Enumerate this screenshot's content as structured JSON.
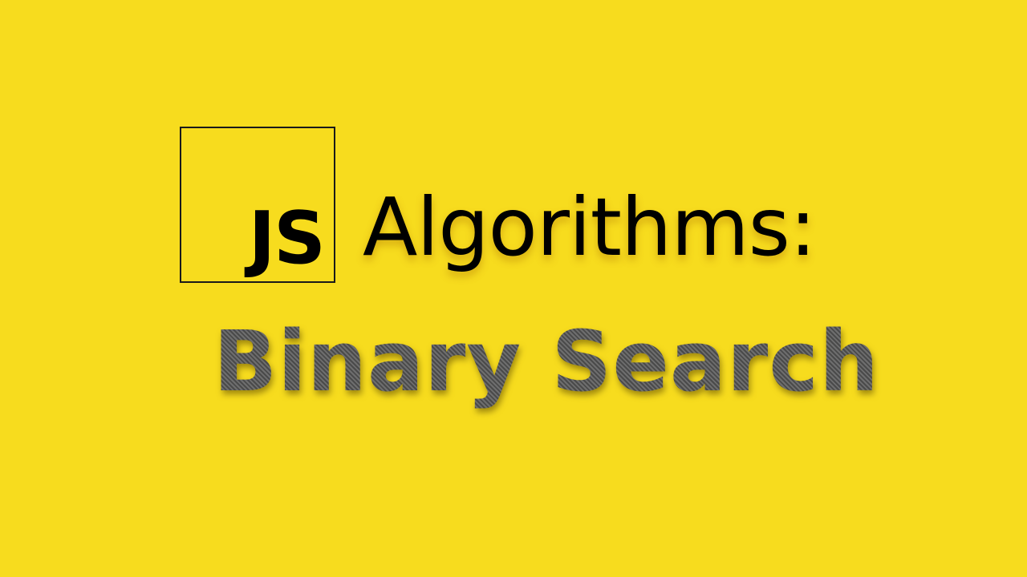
{
  "slide": {
    "logo": {
      "text": "JS"
    },
    "title": "Algorithms:",
    "subtitle": "Binary Search"
  },
  "colors": {
    "background": "#f7dc1e",
    "title_text": "#000000",
    "subtitle_text": "#5a5a5a",
    "logo_border": "#1a1a1a"
  }
}
